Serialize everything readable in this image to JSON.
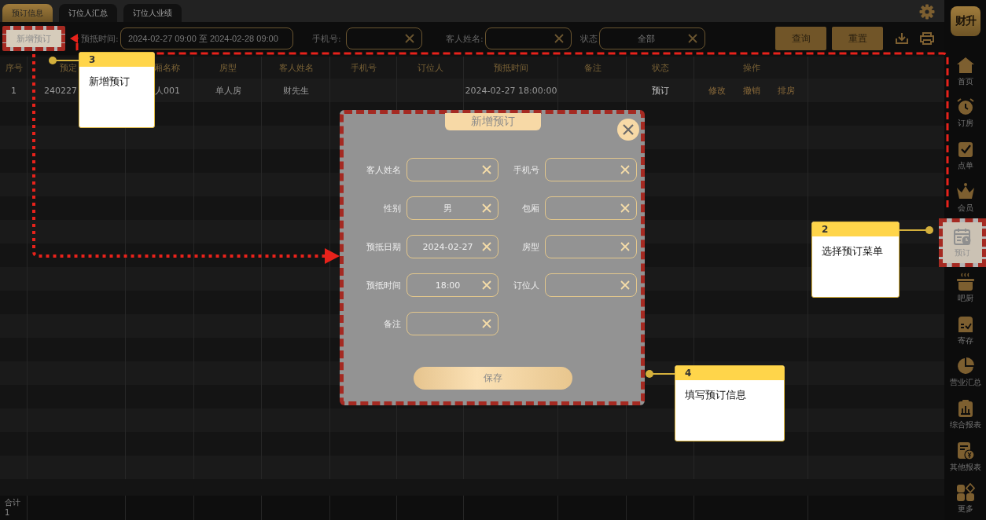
{
  "tabs": [
    {
      "label": "预订信息",
      "selected": true
    },
    {
      "label": "订位人汇总",
      "selected": false
    },
    {
      "label": "订位人业绩",
      "selected": false
    }
  ],
  "toolbar": {
    "new_button": {
      "label": "新增预订",
      "highlighted": true
    },
    "filters": [
      {
        "label": "预抵时间:",
        "value": "2024-02-27 09:00 至 2024-02-28 09:00",
        "clearable": false
      },
      {
        "label": "手机号:",
        "clearable": true
      },
      {
        "label": "客人姓名:",
        "clearable": true
      },
      {
        "label": "状态",
        "value": "全部",
        "clearable": true
      }
    ],
    "buttons": [
      "查询",
      "重置"
    ]
  },
  "table": {
    "columns": [
      "序号",
      "预定",
      "厢名称",
      "房型",
      "客人姓名",
      "手机号",
      "订位人",
      "预抵时间",
      "备注",
      "状态",
      "操作"
    ],
    "rows": [
      {
        "no": "1",
        "booking_no": "240227",
        "room_name": "人001",
        "room_type": "单人房",
        "guest": "财先生",
        "arrival": "2024-02-27 18:00:00",
        "status": "预订",
        "actions": [
          "修改",
          "撤销",
          "排房"
        ]
      }
    ],
    "footer": {
      "label": "合计",
      "count": "1"
    }
  },
  "sidebar": {
    "logo": "财升",
    "items": [
      {
        "label": "首页",
        "selected": false,
        "highlighted": false
      },
      {
        "label": "订房",
        "selected": false,
        "highlighted": false
      },
      {
        "label": "点单",
        "selected": false,
        "highlighted": false
      },
      {
        "label": "会员",
        "selected": false,
        "highlighted": false
      },
      {
        "label": "预订",
        "selected": true,
        "highlighted": true
      },
      {
        "label": "吧厨",
        "selected": false,
        "highlighted": false
      },
      {
        "label": "寄存",
        "selected": false,
        "highlighted": false
      },
      {
        "label": "营业汇总",
        "selected": false,
        "highlighted": false
      },
      {
        "label": "综合报表",
        "selected": false,
        "highlighted": false
      },
      {
        "label": "其他报表",
        "selected": false,
        "highlighted": false
      },
      {
        "label": "更多",
        "selected": false,
        "highlighted": false
      }
    ]
  },
  "dialog": {
    "title": "新增预订",
    "highlighted": true,
    "fields": [
      {
        "label": "客人姓名"
      },
      {
        "label": "手机号"
      },
      {
        "label": "性别",
        "value": "男"
      },
      {
        "label": "包厢"
      },
      {
        "label": "预抵日期",
        "value": "2024-02-27"
      },
      {
        "label": "房型"
      },
      {
        "label": "预抵时间",
        "value": "18:00"
      },
      {
        "label": "订位人"
      },
      {
        "label": "备注"
      }
    ],
    "save_button": "保存"
  },
  "callouts": [
    {
      "number": "3",
      "text": "新增预订"
    },
    {
      "number": "2",
      "text": "选择预订菜单"
    },
    {
      "number": "4",
      "text": "填写预订信息"
    }
  ]
}
